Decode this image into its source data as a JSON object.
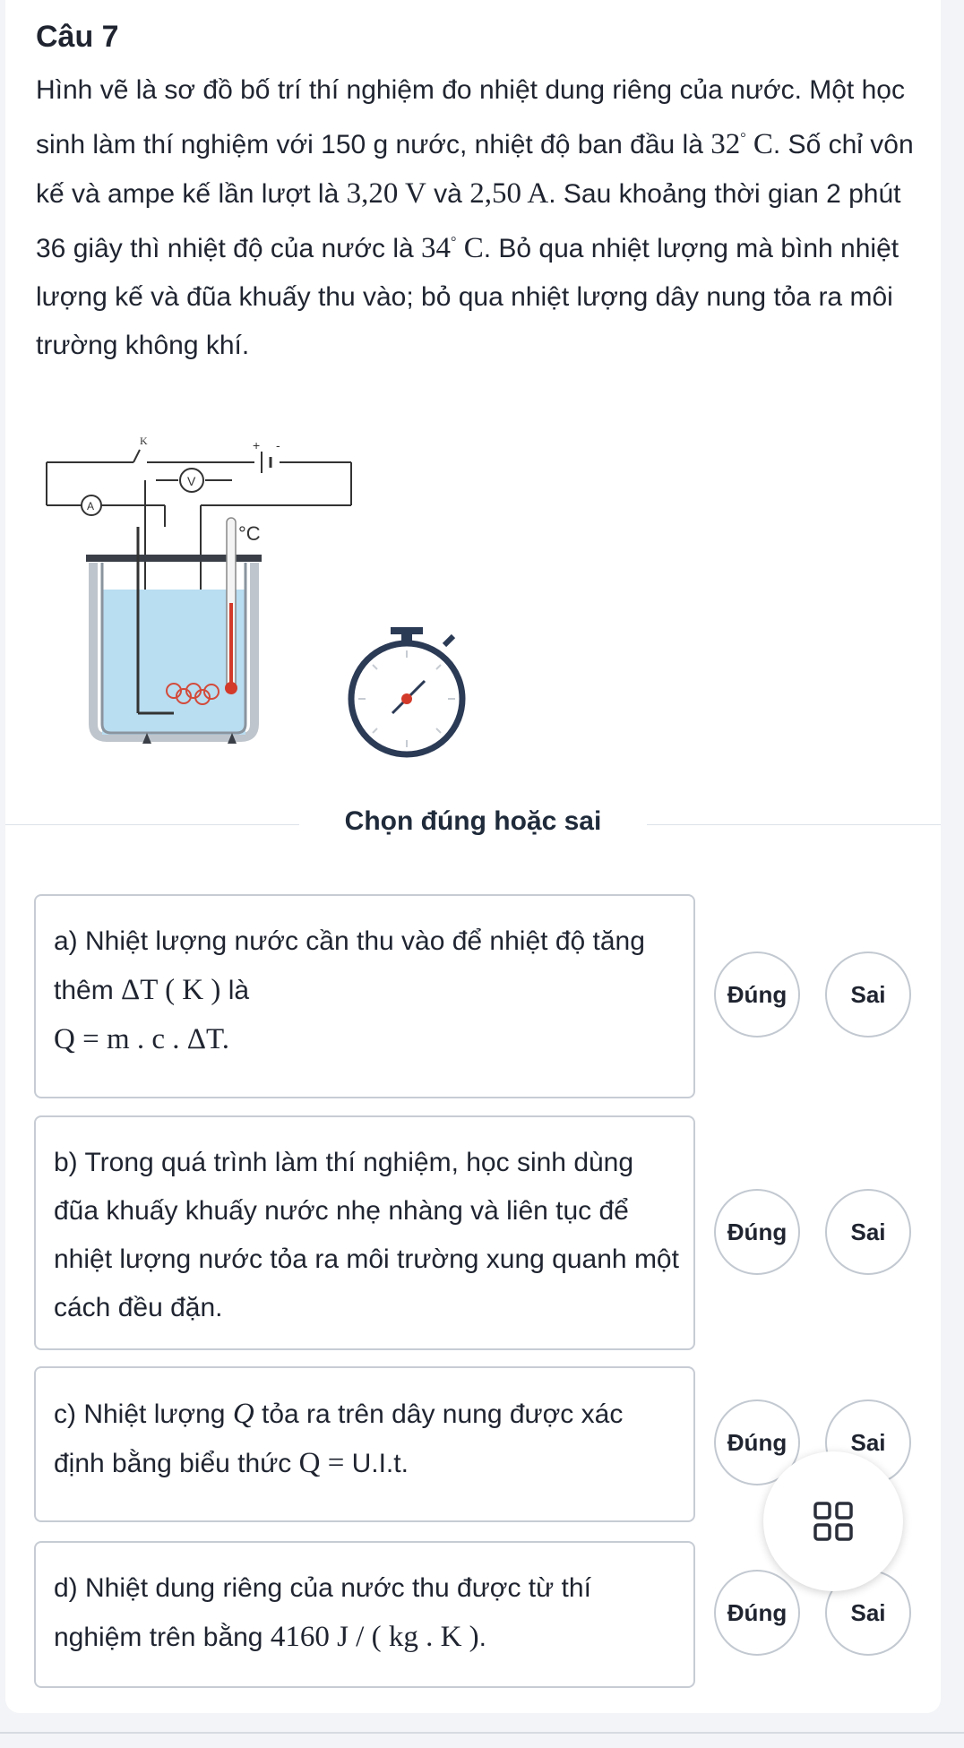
{
  "question": {
    "title": "Câu 7",
    "text": {
      "p1": "Hình vẽ là sơ đồ bố trí thí nghiệm đo nhiệt dung riêng của nước. Một học sinh làm thí nghiệm với 150 g nước, nhiệt độ ban đầu là ",
      "t1": "32",
      "deg_unit": "C",
      "p2": ". Số chỉ vôn kế và ampe kế lần lượt là ",
      "voltage": "3,20 V",
      "and": " và ",
      "current": "2,50 A",
      "p3": ". Sau khoảng thời gian 2 phút 36 giây thì nhiệt độ của nước là ",
      "t2": "34",
      "p4": ". Bỏ qua nhiệt lượng mà bình nhiệt lượng kế và đũa khuấy thu vào; bỏ qua nhiệt lượng dây nung tỏa ra môi trường không khí."
    }
  },
  "figure": {
    "switch_label": "K",
    "voltmeter_label": "V",
    "ammeter_label": "A",
    "thermometer_unit": "°C",
    "battery_plus": "+",
    "battery_minus": "-"
  },
  "divider_label": "Chọn đúng hoặc sai",
  "statements": {
    "a": {
      "prefix": "a) Nhiệt lượng nước cần thu vào để nhiệt độ tăng thêm ",
      "dT": "ΔT ( K )",
      "mid": " là",
      "formula": "Q = m . c . ΔT."
    },
    "b": {
      "text": "b) Trong quá trình làm thí nghiệm, học sinh dùng đũa khuấy khuấy nước nhẹ nhàng và liên tục để nhiệt lượng nước tỏa ra môi trường xung quanh một cách đều đặn."
    },
    "c": {
      "prefix": "c) Nhiệt lượng ",
      "Q": "Q",
      "mid": " tỏa ra trên dây nung được xác định bằng biểu thức ",
      "formula": "Q = ",
      "formula_tail": "U.I.t."
    },
    "d": {
      "prefix": "d) Nhiệt dung riêng của nước thu được từ thí nghiệm trên bằng ",
      "value": "4160 J / ( kg . K )",
      "end": "."
    }
  },
  "choices": {
    "true_label": "Đúng",
    "false_label": "Sai"
  },
  "icons": {
    "fab": "grid-icon"
  },
  "colors": {
    "water": "#b9ddf1",
    "divider_text": "#1f2a3a",
    "choice_border": "#c3c9d1"
  }
}
